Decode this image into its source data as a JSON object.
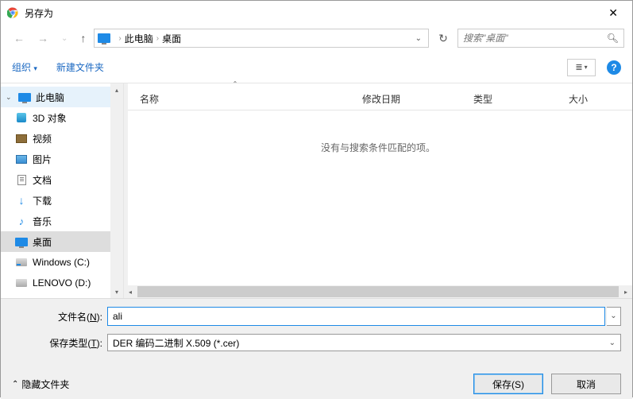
{
  "title": "另存为",
  "breadcrumb": {
    "root": "此电脑",
    "current": "桌面"
  },
  "search": {
    "placeholder": "搜索\"桌面\""
  },
  "toolbar": {
    "organize": "组织",
    "new_folder": "新建文件夹"
  },
  "sidebar": {
    "root": "此电脑",
    "items": [
      {
        "label": "3D 对象"
      },
      {
        "label": "视频"
      },
      {
        "label": "图片"
      },
      {
        "label": "文档"
      },
      {
        "label": "下载"
      },
      {
        "label": "音乐"
      },
      {
        "label": "桌面"
      },
      {
        "label": "Windows (C:)"
      },
      {
        "label": "LENOVO (D:)"
      }
    ]
  },
  "columns": {
    "name": "名称",
    "date": "修改日期",
    "type": "类型",
    "size": "大小"
  },
  "empty_message": "没有与搜索条件匹配的项。",
  "form": {
    "filename_label_pre": "文件名(",
    "filename_label_key": "N",
    "filename_label_post": "):",
    "filename_value": "ali",
    "filetype_label_pre": "保存类型(",
    "filetype_label_key": "T",
    "filetype_label_post": "):",
    "filetype_value": "DER 编码二进制 X.509 (*.cer)"
  },
  "footer": {
    "hide_folders": "隐藏文件夹",
    "save": "保存(S)",
    "cancel": "取消"
  }
}
